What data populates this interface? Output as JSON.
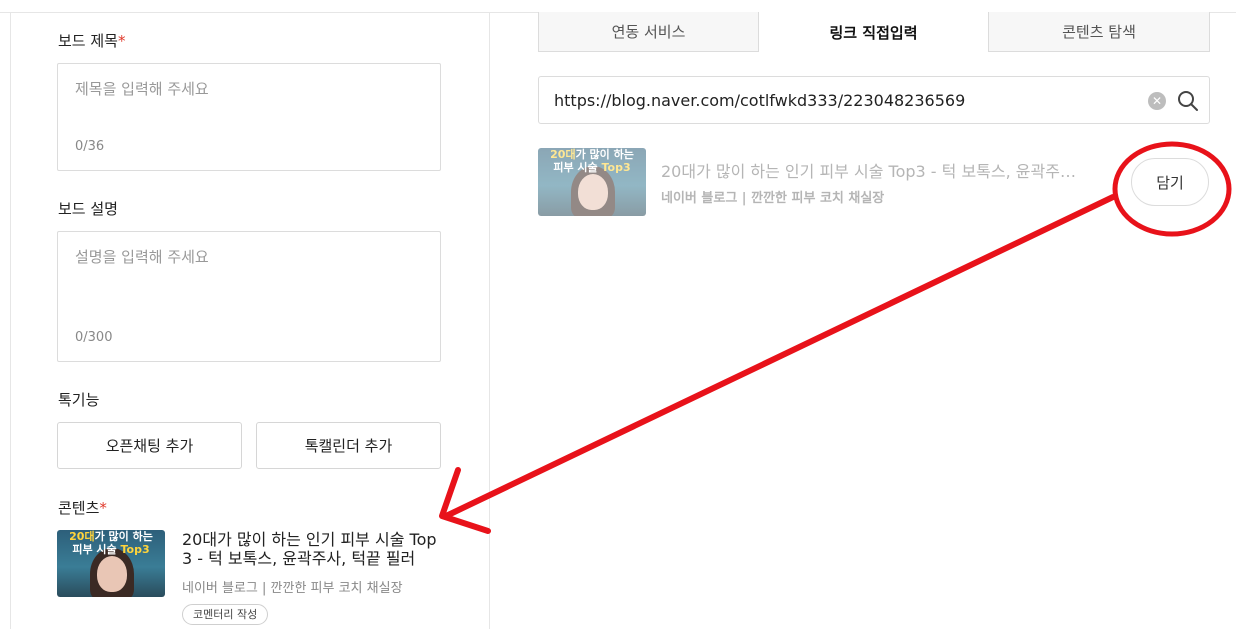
{
  "left": {
    "board_title": {
      "label": "보드 제목",
      "required": "*",
      "placeholder": "제목을 입력해 주세요",
      "count": "0/36"
    },
    "board_desc": {
      "label": "보드 설명",
      "placeholder": "설명을 입력해 주세요",
      "count": "0/300"
    },
    "talk_features": {
      "label": "톡기능",
      "open_chat_button": "오픈채팅 추가",
      "talk_calendar_button": "톡캘린더 추가"
    },
    "contents": {
      "label": "콘텐츠",
      "required": "*",
      "item": {
        "thumb_line1": "20대가 많이 하는",
        "thumb_line1_highlight": "20대",
        "thumb_line1_rest": "가 많이 하는",
        "thumb_line2_a": "피부 시술 ",
        "thumb_line2_b": "Top3",
        "title": "20대가 많이 하는 인기 피부 시술 Top 3 - 턱 보톡스, 윤곽주사, 턱끝 필러",
        "source": "네이버 블로그 | 깐깐한 피부 코치 채실장",
        "tag": "코멘터리 작성"
      }
    }
  },
  "right": {
    "tabs": [
      {
        "label": "연동 서비스",
        "active": false
      },
      {
        "label": "링크 직접입력",
        "active": true
      },
      {
        "label": "콘텐츠 탐색",
        "active": false
      }
    ],
    "search": {
      "value": "https://blog.naver.com/cotlfwkd333/223048236569",
      "clear_icon": "✕"
    },
    "result": {
      "thumb_line1_highlight": "20대",
      "thumb_line1_rest": "가 많이 하는",
      "thumb_line2_a": "피부 시술 ",
      "thumb_line2_b": "Top3",
      "title": "20대가 많이 하는 인기 피부 시술 Top3 - 턱 보톡스, 윤곽주…",
      "source": "네이버 블로그 | 깐깐한 피부 코치 채실장",
      "add_button": "담기"
    }
  },
  "annotation": {
    "color": "#e8121a",
    "shapes": [
      "circle around add button",
      "arrow to selected content"
    ]
  }
}
